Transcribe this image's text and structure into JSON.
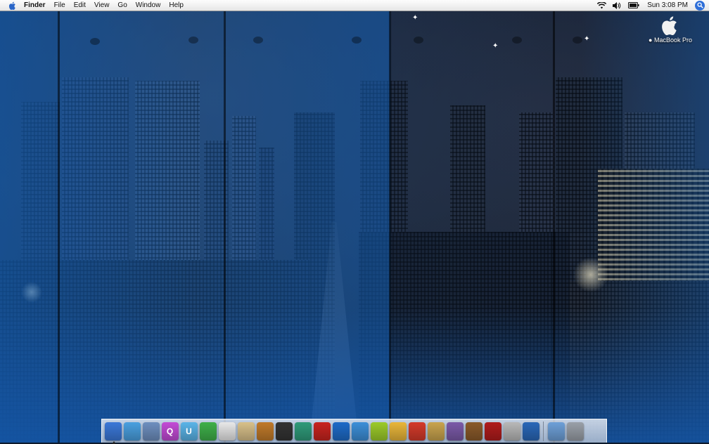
{
  "menubar": {
    "app_name": "Finder",
    "menus": [
      "File",
      "Edit",
      "View",
      "Go",
      "Window",
      "Help"
    ],
    "clock": "Sun 3:08 PM"
  },
  "desktop": {
    "hard_drive_label": "MacBook Pro"
  },
  "dock": {
    "apps": [
      {
        "icon": "finder-icon",
        "color": "#3b78d8"
      },
      {
        "icon": "safari-icon",
        "color": "#4aa0e0"
      },
      {
        "icon": "mail-stamp-icon",
        "color": "#6e8fbf"
      },
      {
        "icon": "quicksilver-q-icon",
        "color": "#c34bd6",
        "glyph": "Q"
      },
      {
        "icon": "u-app-icon",
        "color": "#5ab4e8",
        "glyph": "U"
      },
      {
        "icon": "green-script-icon",
        "color": "#3eb04a"
      },
      {
        "icon": "mouse-icon",
        "color": "#e8e8e8"
      },
      {
        "icon": "textedit-icon",
        "color": "#d8c08a"
      },
      {
        "icon": "photo-browser-icon",
        "color": "#c07a2a"
      },
      {
        "icon": "camera-lens-icon",
        "color": "#333333"
      },
      {
        "icon": "feather-pen-icon",
        "color": "#2f9b7a"
      },
      {
        "icon": "red-shoe-icon",
        "color": "#c8241f"
      },
      {
        "icon": "dvd-player-icon",
        "color": "#1e6bc8"
      },
      {
        "icon": "itunes-icon",
        "color": "#3d8fd8"
      },
      {
        "icon": "green-gear-icon",
        "color": "#9ccb2a"
      },
      {
        "icon": "mailbox-icon",
        "color": "#e9b63a"
      },
      {
        "icon": "popcorn-icon",
        "color": "#d43a2a"
      },
      {
        "icon": "notepad-icon",
        "color": "#c9a44e"
      },
      {
        "icon": "film-strip-icon",
        "color": "#7b5aa8"
      },
      {
        "icon": "horse-icon",
        "color": "#8a5a2a"
      },
      {
        "icon": "dvd-studio-icon",
        "color": "#b01c1c"
      },
      {
        "icon": "apple-tv-icon",
        "color": "#b8b8b8"
      },
      {
        "icon": "globe-icon",
        "color": "#2a68b8"
      }
    ],
    "docs": [
      {
        "icon": "window-preview-icon",
        "color": "#6ea0d8"
      },
      {
        "icon": "trash-icon",
        "color": "#9aa0a8"
      }
    ]
  }
}
